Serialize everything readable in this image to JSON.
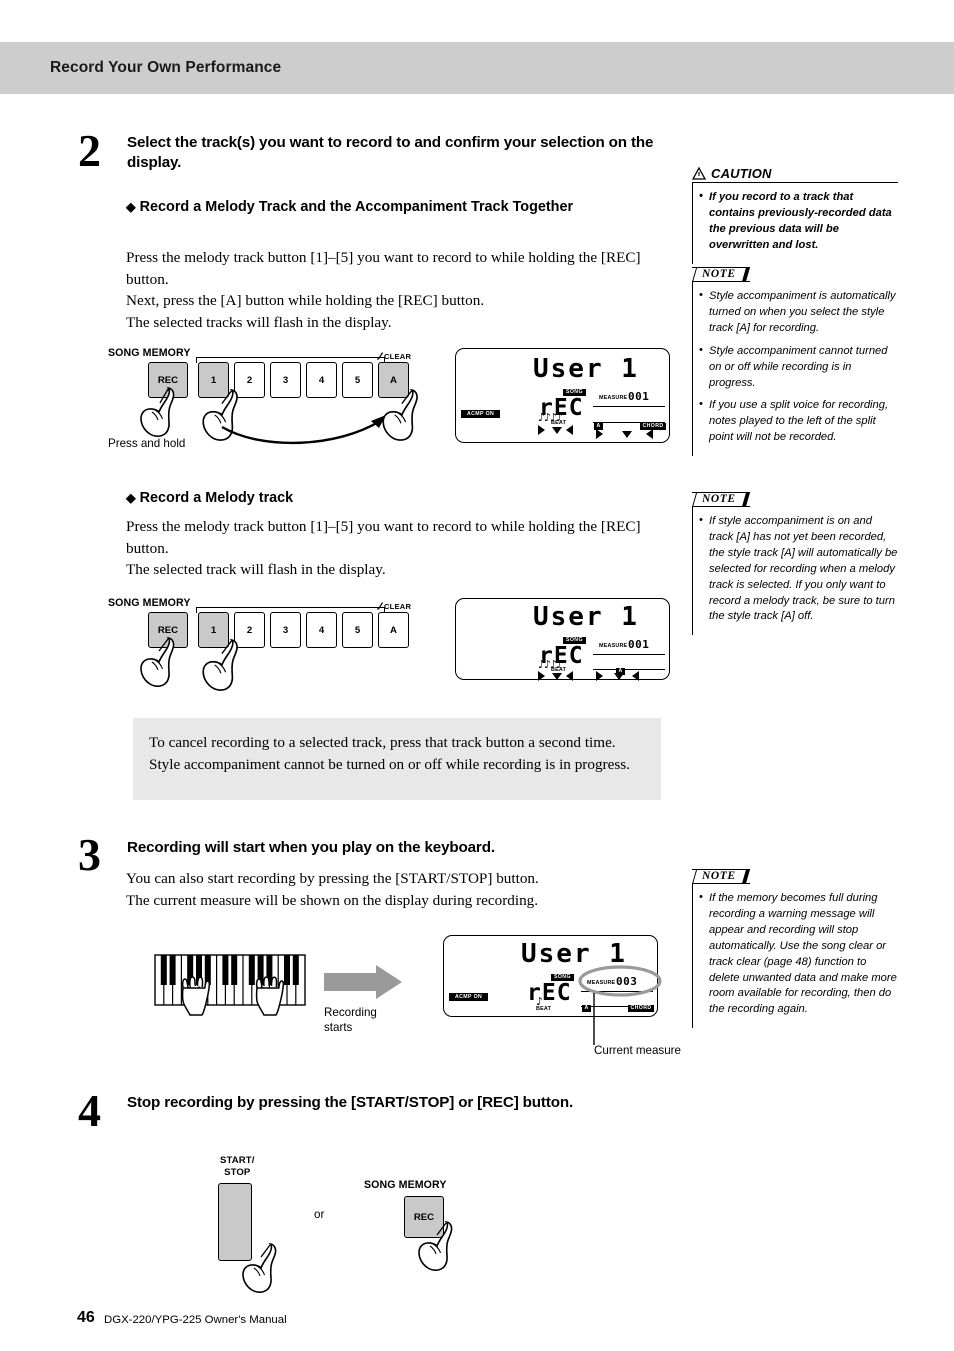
{
  "header": {
    "title": "Record Your Own Performance"
  },
  "steps": [
    {
      "number": "2",
      "heading": "Select the track(s) you want to record to and confirm your selection on the display.",
      "sub_sections": [
        {
          "title": "Record a Melody Track and the Accompaniment Track Together",
          "body": "Press the melody track button [1]–[5] you want to record to while holding the [REC] button.\nNext, press the [A] button while holding the [REC] button.\nThe selected tracks will flash in the display."
        },
        {
          "title": "Record a Melody track",
          "body": "Press the melody track button [1]–[5] you want to record to while holding the [REC] button.\nThe selected track will flash in the display."
        }
      ]
    },
    {
      "number": "3",
      "heading": "Recording will start when you play on the keyboard.",
      "body": "You can also start recording by pressing the [START/STOP] button.\nThe current measure will be shown on the display during recording."
    },
    {
      "number": "4",
      "heading": "Stop recording by pressing the [START/STOP] or [REC] button."
    }
  ],
  "tip_box": {
    "text": "To cancel recording to a selected track, press that track button a second time. Style accompaniment cannot be turned on or off while recording is in progress."
  },
  "side_notes": [
    {
      "type": "caution",
      "label": "CAUTION",
      "items": [
        "If you record to a track that contains previously-recorded data the previous data will be overwritten and lost."
      ]
    },
    {
      "type": "note",
      "label": "NOTE",
      "items": [
        "Style accompaniment is automatically turned on when you select the style track [A] for recording.",
        "Style accompaniment cannot turned on or off while recording is in progress.",
        "If you use a split voice for recording, notes played to the left of the split point will not be recorded."
      ]
    },
    {
      "type": "note",
      "label": "NOTE",
      "items": [
        "If style accompaniment is on and track [A] has not yet been recorded, the style track [A] will automatically be selected for recording when a melody track is selected. If you only want to record a melody track, be sure to turn the style track [A] off."
      ]
    },
    {
      "type": "note",
      "label": "NOTE",
      "items": [
        "If the memory becomes full during recording a warning message will appear and recording will stop automatically. Use the song clear or track clear (page 48) function to delete unwanted data and make more room available for recording, then do the recording again."
      ]
    }
  ],
  "panel_diagram_1": {
    "group_label": "SONG MEMORY",
    "clear_label": "CLEAR",
    "rec_label": "REC",
    "track_buttons": [
      "1",
      "2",
      "3",
      "4",
      "5",
      "A"
    ],
    "highlighted": [
      "REC",
      "1",
      "A"
    ],
    "caption": "Press and hold"
  },
  "panel_diagram_2": {
    "group_label": "SONG MEMORY",
    "clear_label": "CLEAR",
    "rec_label": "REC",
    "track_buttons": [
      "1",
      "2",
      "3",
      "4",
      "5",
      "A"
    ],
    "highlighted": [
      "REC",
      "1"
    ]
  },
  "lcd_1": {
    "title": "User 1",
    "status": "rEC",
    "song_badge": "SONG",
    "acmp_badge": "ACMP ON",
    "measure_label": "MEASURE",
    "measure_value": "001",
    "beat_label": "BEAT",
    "left_indicator": "A",
    "right_indicator": "CHORD"
  },
  "lcd_2": {
    "title": "User 1",
    "status": "rEC",
    "song_badge": "SONG",
    "measure_label": "MEASURE",
    "measure_value": "001",
    "beat_label": "BEAT",
    "left_indicator": "A"
  },
  "lcd_3": {
    "title": "User 1",
    "status": "rEC",
    "song_badge": "SONG",
    "acmp_badge": "ACMP ON",
    "measure_label": "MEASURE",
    "measure_value": "003",
    "beat_label": "BEAT",
    "left_indicator": "A",
    "right_indicator": "CHORD",
    "callout": "Current measure"
  },
  "keyboard_diagram": {
    "arrow_caption_line1": "Recording",
    "arrow_caption_line2": "starts"
  },
  "stop_diagram": {
    "start_stop_label_line1": "START/",
    "start_stop_label_line2": "STOP",
    "or_label": "or",
    "song_memory_label": "SONG MEMORY",
    "rec_label": "REC"
  },
  "footer": {
    "page_number": "46",
    "manual_title": "DGX-220/YPG-225  Owner's Manual"
  },
  "colors": {
    "header_band": "#cdcdcd",
    "button_highlight": "#c9c9c9",
    "tip_box": "#e8e8e8",
    "arrow": "#9a9a9a"
  }
}
